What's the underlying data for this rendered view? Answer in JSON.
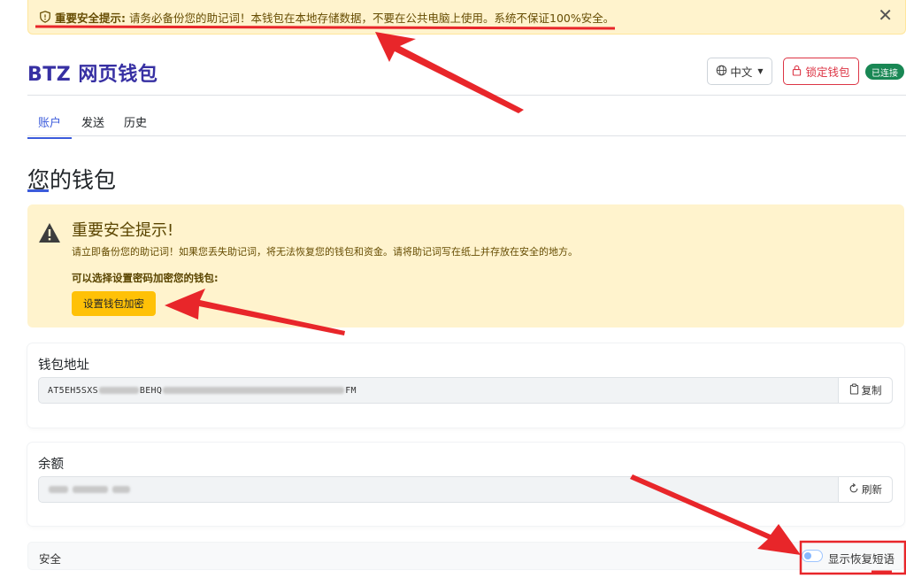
{
  "top_alert": {
    "title": "重要安全提示:",
    "message": "请务必备份您的助记词！本钱包在本地存储数据，不要在公共电脑上使用。系统不保证100%安全。",
    "close_glyph": "✕"
  },
  "header": {
    "brand": "BTZ 网页钱包",
    "language": "中文",
    "lock_label": "锁定钱包",
    "status_badge": "已连接"
  },
  "tabs": [
    {
      "label": "账户",
      "active": true
    },
    {
      "label": "发送",
      "active": false
    },
    {
      "label": "历史",
      "active": false
    }
  ],
  "page_title": "您的钱包",
  "warning_card": {
    "title": "重要安全提示!",
    "description": "请立即备份您的助记词！如果您丢失助记词，将无法恢复您的钱包和资金。请将助记词写在纸上并存放在安全的地方。",
    "subtitle": "可以选择设置密码加密您的钱包:",
    "button": "设置钱包加密"
  },
  "address_card": {
    "label": "钱包地址",
    "value_start": "AT5EH5SXS",
    "value_mid": "BEHQ",
    "value_end": "FM",
    "copy_label": "复制"
  },
  "balance_card": {
    "label": "余额",
    "refresh_label": "刷新"
  },
  "security": {
    "label": "安全",
    "toggle_label": "显示恢复短语"
  },
  "colors": {
    "brand": "#3730a3",
    "accent": "#3b5bdb",
    "warning_bg": "#fff3cd",
    "warning_button": "#ffc107",
    "danger": "#dc3545",
    "success": "#198754",
    "annotation_red": "#e8262a"
  }
}
